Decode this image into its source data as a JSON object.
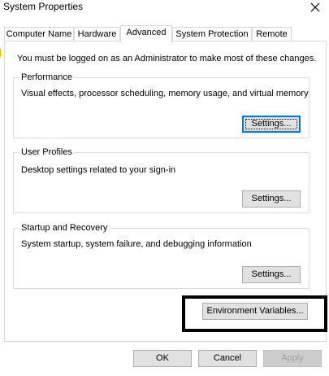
{
  "window": {
    "title": "System Properties",
    "close_icon": "close-icon"
  },
  "tabs": [
    {
      "label": "Computer Name",
      "active": false
    },
    {
      "label": "Hardware",
      "active": false
    },
    {
      "label": "Advanced",
      "active": true
    },
    {
      "label": "System Protection",
      "active": false
    },
    {
      "label": "Remote",
      "active": false
    }
  ],
  "advanced": {
    "admin_note": "You must be logged on as an Administrator to make most of these changes.",
    "performance": {
      "title": "Performance",
      "description": "Visual effects, processor scheduling, memory usage, and virtual memory",
      "button": "Settings..."
    },
    "user_profiles": {
      "title": "User Profiles",
      "description": "Desktop settings related to your sign-in",
      "button": "Settings..."
    },
    "startup_recovery": {
      "title": "Startup and Recovery",
      "description": "System startup, system failure, and debugging information",
      "button": "Settings..."
    },
    "env_button": "Environment Variables..."
  },
  "footer": {
    "ok": "OK",
    "cancel": "Cancel",
    "apply": "Apply"
  },
  "colors": {
    "focus_blue": "#0078d7",
    "highlight_border": "#000000"
  }
}
